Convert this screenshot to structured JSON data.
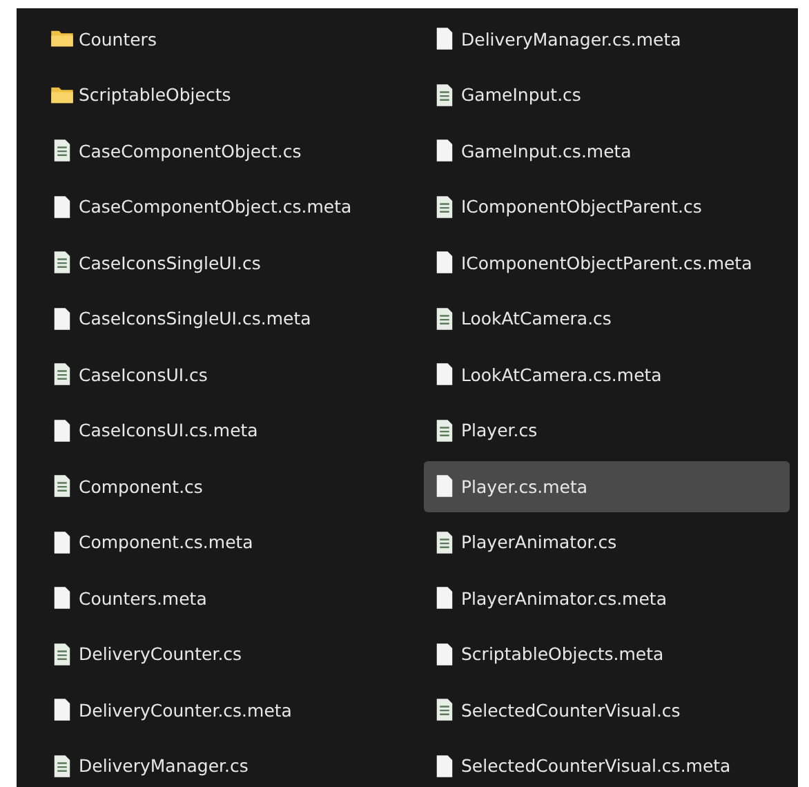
{
  "items": [
    {
      "name": "Counters",
      "kind": "folder",
      "selected": false
    },
    {
      "name": "ScriptableObjects",
      "kind": "folder",
      "selected": false
    },
    {
      "name": "CaseComponentObject.cs",
      "kind": "script",
      "selected": false
    },
    {
      "name": "CaseComponentObject.cs.meta",
      "kind": "meta",
      "selected": false
    },
    {
      "name": "CaseIconsSingleUI.cs",
      "kind": "script",
      "selected": false
    },
    {
      "name": "CaseIconsSingleUI.cs.meta",
      "kind": "meta",
      "selected": false
    },
    {
      "name": "CaseIconsUI.cs",
      "kind": "script",
      "selected": false
    },
    {
      "name": "CaseIconsUI.cs.meta",
      "kind": "meta",
      "selected": false
    },
    {
      "name": "Component.cs",
      "kind": "script",
      "selected": false
    },
    {
      "name": "Component.cs.meta",
      "kind": "meta",
      "selected": false
    },
    {
      "name": "Counters.meta",
      "kind": "meta",
      "selected": false
    },
    {
      "name": "DeliveryCounter.cs",
      "kind": "script",
      "selected": false
    },
    {
      "name": "DeliveryCounter.cs.meta",
      "kind": "meta",
      "selected": false
    },
    {
      "name": "DeliveryManager.cs",
      "kind": "script",
      "selected": false
    },
    {
      "name": "DeliveryManager.cs.meta",
      "kind": "meta",
      "selected": false
    },
    {
      "name": "GameInput.cs",
      "kind": "script",
      "selected": false
    },
    {
      "name": "GameInput.cs.meta",
      "kind": "meta",
      "selected": false
    },
    {
      "name": "IComponentObjectParent.cs",
      "kind": "script",
      "selected": false
    },
    {
      "name": "IComponentObjectParent.cs.meta",
      "kind": "meta",
      "selected": false
    },
    {
      "name": "LookAtCamera.cs",
      "kind": "script",
      "selected": false
    },
    {
      "name": "LookAtCamera.cs.meta",
      "kind": "meta",
      "selected": false
    },
    {
      "name": "Player.cs",
      "kind": "script",
      "selected": false
    },
    {
      "name": "Player.cs.meta",
      "kind": "meta",
      "selected": true
    },
    {
      "name": "PlayerAnimator.cs",
      "kind": "script",
      "selected": false
    },
    {
      "name": "PlayerAnimator.cs.meta",
      "kind": "meta",
      "selected": false
    },
    {
      "name": "ScriptableObjects.meta",
      "kind": "meta",
      "selected": false
    },
    {
      "name": "SelectedCounterVisual.cs",
      "kind": "script",
      "selected": false
    },
    {
      "name": "SelectedCounterVisual.cs.meta",
      "kind": "meta",
      "selected": false
    }
  ]
}
